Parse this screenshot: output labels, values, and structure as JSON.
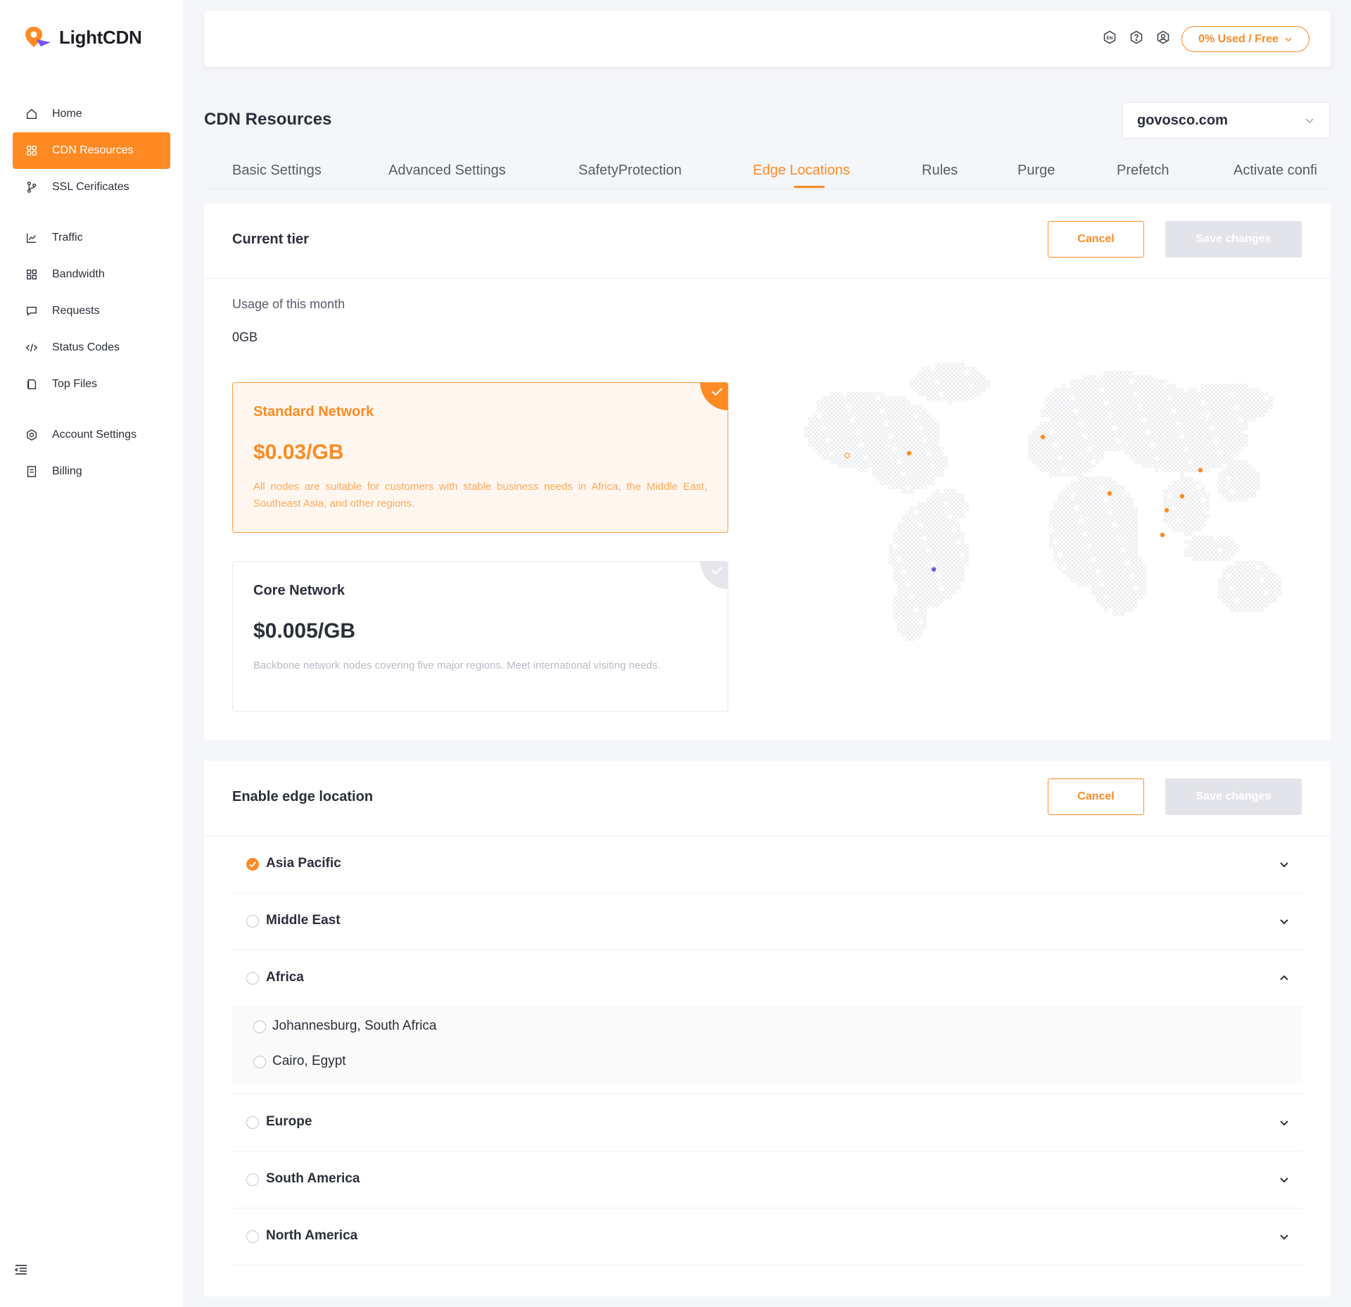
{
  "brand": {
    "name": "LightCDN",
    "accent": "#ff8a24"
  },
  "sidebar": {
    "groups": [
      [
        {
          "label": "Home",
          "icon": "home-icon"
        },
        {
          "label": "CDN Resources",
          "icon": "grid-icon",
          "active": true
        },
        {
          "label": "SSL Cerificates",
          "icon": "branch-icon"
        }
      ],
      [
        {
          "label": "Traffic",
          "icon": "line-chart-icon"
        },
        {
          "label": "Bandwidth",
          "icon": "apps-icon"
        },
        {
          "label": "Requests",
          "icon": "chat-icon"
        },
        {
          "label": "Status Codes",
          "icon": "code-icon"
        },
        {
          "label": "Top Files",
          "icon": "file-icon"
        }
      ],
      [
        {
          "label": "Account Settings",
          "icon": "gear-icon"
        },
        {
          "label": "Billing",
          "icon": "receipt-icon"
        }
      ]
    ]
  },
  "topbar": {
    "usage_label": "0% Used / Free"
  },
  "page": {
    "title": "CDN Resources",
    "domain": "govosco.com"
  },
  "tabs": [
    {
      "label": "Basic Settings"
    },
    {
      "label": "Advanced Settings"
    },
    {
      "label": "SafetyProtection"
    },
    {
      "label": "Edge Locations",
      "active": true
    },
    {
      "label": "Rules"
    },
    {
      "label": "Purge"
    },
    {
      "label": "Prefetch"
    },
    {
      "label": "Activate confi"
    }
  ],
  "tier_panel": {
    "title": "Current tier",
    "cancel_label": "Cancel",
    "save_label": "Save changes",
    "usage_label": "Usage of  this month",
    "usage_value": "0GB",
    "tiers": [
      {
        "name": "Standard Network",
        "price": "$0.03/GB",
        "description": "All nodes are suitable for customers with stable business needs in Africa, the Middle East, Southeast Asia, and other regions.",
        "selected": true
      },
      {
        "name": "Core Network",
        "price": "$0.005/GB",
        "description": "Backbone network nodes covering five major regions. Meet international visiting needs.",
        "selected": false
      }
    ]
  },
  "edge_panel": {
    "title": "Enable edge location",
    "cancel_label": "Cancel",
    "save_label": "Save changes",
    "regions": [
      {
        "name": "Asia Pacific",
        "checked": true,
        "expanded": false,
        "children": []
      },
      {
        "name": "Middle East",
        "checked": false,
        "expanded": false,
        "children": []
      },
      {
        "name": "Africa",
        "checked": false,
        "expanded": true,
        "children": [
          "Johannesburg, South Africa",
          "Cairo, Egypt"
        ]
      },
      {
        "name": "Europe",
        "checked": false,
        "expanded": false,
        "children": []
      },
      {
        "name": "South America",
        "checked": false,
        "expanded": false,
        "children": []
      },
      {
        "name": "North America",
        "checked": false,
        "expanded": false,
        "children": []
      }
    ]
  }
}
